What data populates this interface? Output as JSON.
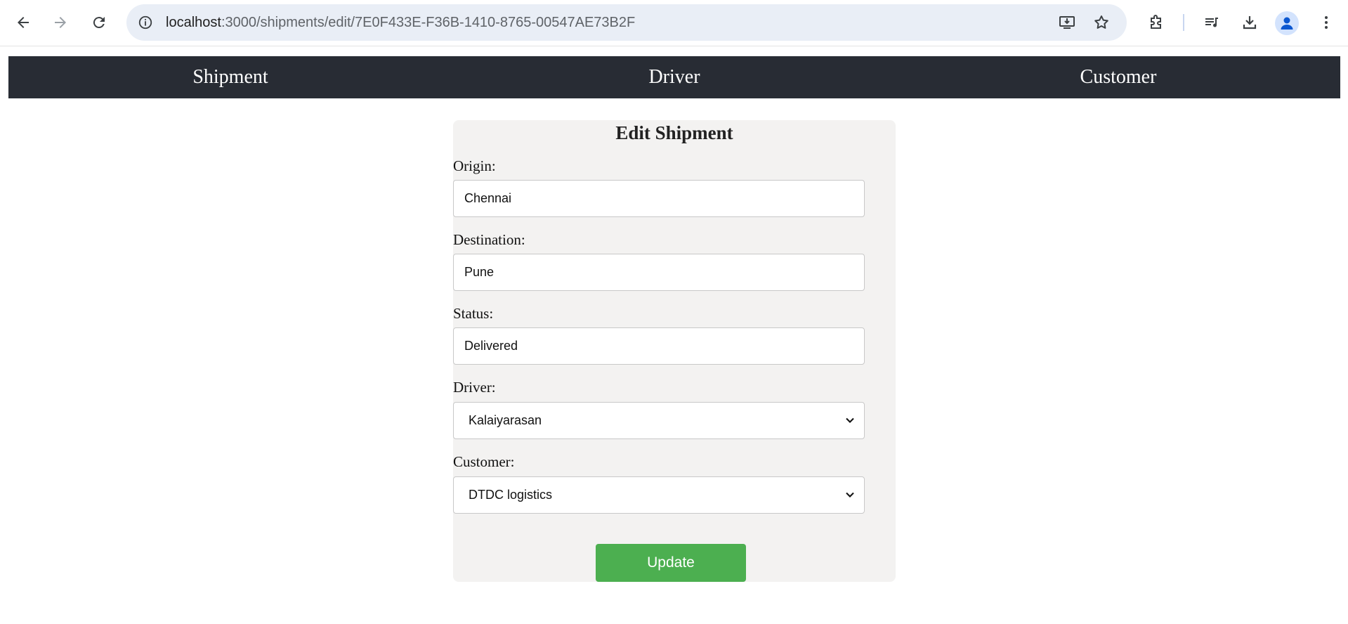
{
  "browser": {
    "url_host": "localhost",
    "url_path": ":3000/shipments/edit/7E0F433E-F36B-1410-8765-00547AE73B2F"
  },
  "nav": {
    "items": [
      {
        "label": "Shipment"
      },
      {
        "label": "Driver"
      },
      {
        "label": "Customer"
      }
    ]
  },
  "form": {
    "title": "Edit Shipment",
    "origin": {
      "label": "Origin:",
      "value": "Chennai"
    },
    "destination": {
      "label": "Destination:",
      "value": "Pune"
    },
    "status": {
      "label": "Status:",
      "value": "Delivered"
    },
    "driver": {
      "label": "Driver:",
      "value": "Kalaiyarasan"
    },
    "customer": {
      "label": "Customer:",
      "value": "DTDC logistics"
    },
    "submit_label": "Update"
  },
  "colors": {
    "navbar_bg": "#282c34",
    "card_bg": "#f3f2f1",
    "button_bg": "#4caf50"
  }
}
